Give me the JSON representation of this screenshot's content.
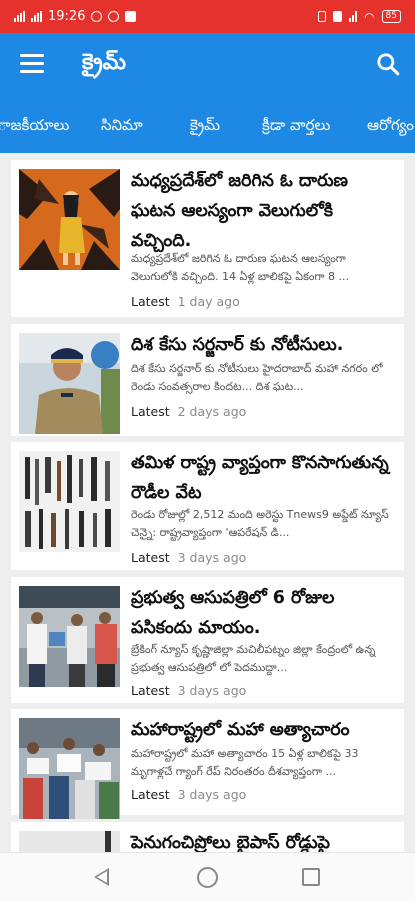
{
  "status_bar": {
    "left_text": "19:26",
    "battery": "85"
  },
  "app_bar": {
    "title": "క్రైమ్",
    "menu_icon": "menu-icon",
    "search_icon": "search-icon"
  },
  "tabs": [
    "ాజకీయాలు",
    "సినిమా",
    "క్రైమ్",
    "క్రీడా వార్తలు",
    "ఆరోగ్యం"
  ],
  "articles": [
    {
      "title": "మధ్యప్రదేశ్‌లో జరిగిన ఓ దారుణ ఘటన ఆలస్యంగా వెలుగులోకి వచ్చింది.",
      "snippet": "మధ్యప్రదేశ్‌లో జరిగిన ఓ దారుణ ఘటన ఆలస్యంగా వెలుగులోకి వచ్చింది. 14 ఏళ్ల బాలికపై ఏకంగా 8 ...",
      "label": "Latest",
      "time": "1 day ago"
    },
    {
      "title": "దిశ కేసు సర్జనార్ కు నోటీసులు.",
      "snippet": "దిశ కేసు సర్జనార్ కు నోటీసులు హైదరాబాద్ మహా నగరం లో రెండు సంవత్సరాల కిందట... దిశ ఘట...",
      "label": "Latest",
      "time": "2 days ago"
    },
    {
      "title": "తమిళ రాష్ట్ర వ్యాప్తంగా కొనసాగుతున్న రౌడీల వేట",
      "snippet": "రెండు రోజుల్లో 2,512 మంది అరెస్టు Tnews9 అప్డేట్ న్యూస్ చెన్నై: రాష్ట్రవ్యాప్తంగా 'ఆపరేషన్ డి...",
      "label": "Latest",
      "time": "3 days ago"
    },
    {
      "title": "ప్రభుత్వ ఆసుపత్రిలో 6 రోజుల పసికందు మాయం.",
      "snippet": "బ్రేకింగ్ న్యూస్ కృష్ణాజిల్లా మచిలీపట్నం జిల్లా కేంద్రంలో ఉన్న ప్రభుత్వ ఆసుపత్రిలో లో పెదముద్దా...",
      "label": "Latest",
      "time": "3 days ago"
    },
    {
      "title": "మహారాష్ట్రలో మహా అత్యాచారం",
      "snippet": "మహారాష్ట్రలో మహా అత్యాచారం 15 ఏళ్ల బాలికపై 33 మృగాళ్లచే గ్యాంగ్ రేప్ నిరంతరం దీశవ్యాప్తంగా ...",
      "label": "Latest",
      "time": "3 days ago"
    },
    {
      "title": "పెనుగంచిప్రోలు బైపాస్ రోడ్డుపై",
      "snippet": "",
      "label": "",
      "time": ""
    }
  ],
  "nav_bar": {
    "back_icon": "back-icon",
    "home_icon": "home-icon",
    "recents_icon": "recents-icon"
  },
  "colors": {
    "status_bar": "#e5322d",
    "app_bar": "#1e88e5",
    "background": "#eeeeee"
  }
}
